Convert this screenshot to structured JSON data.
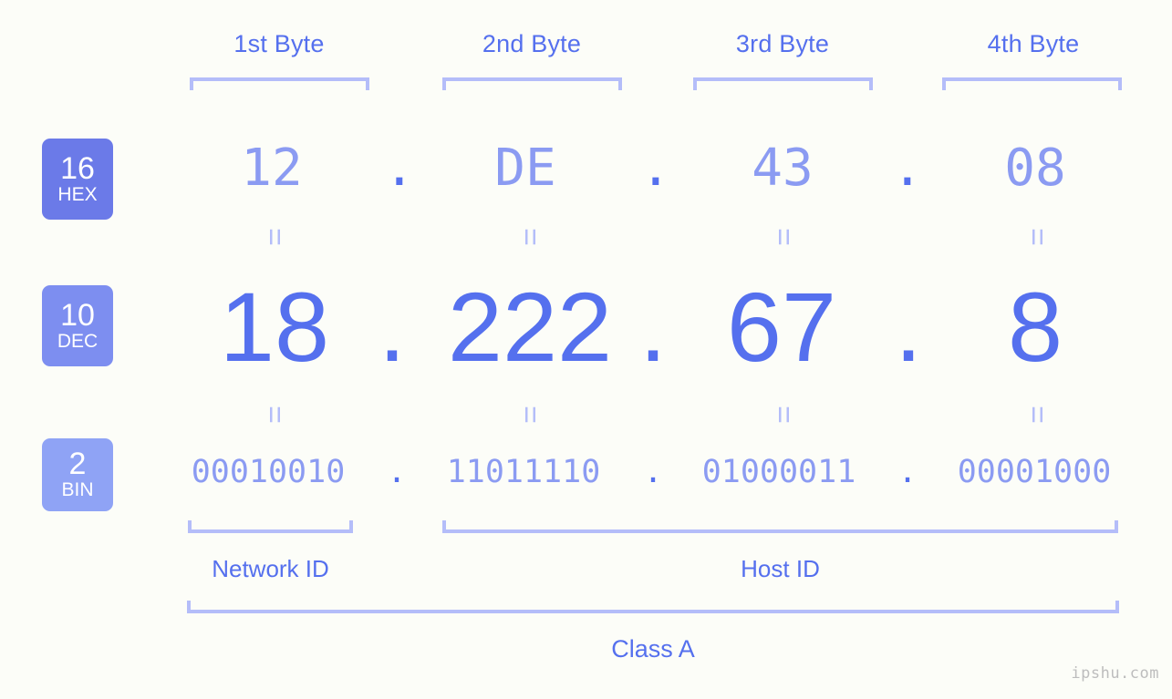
{
  "background_color": "#fcfdf8",
  "accent_colors": {
    "strong_blue": "#5570ee",
    "mid_blue": "#8b9bf2",
    "light_blue": "#b4bdf9",
    "badge_hex": "#6b7ae8",
    "badge_dec": "#7d8ef0",
    "badge_bin": "#8fa3f5",
    "watermark_gray": "#bdbdbd"
  },
  "byte_headers": [
    {
      "label": "1st Byte"
    },
    {
      "label": "2nd Byte"
    },
    {
      "label": "3rd Byte"
    },
    {
      "label": "4th Byte"
    }
  ],
  "bases": [
    {
      "number": "16",
      "name": "HEX"
    },
    {
      "number": "10",
      "name": "DEC"
    },
    {
      "number": "2",
      "name": "BIN"
    }
  ],
  "rows": {
    "hex": {
      "values": [
        "12",
        "DE",
        "43",
        "08"
      ],
      "separator": "."
    },
    "dec": {
      "values": [
        "18",
        "222",
        "67",
        "8"
      ],
      "separator": "."
    },
    "bin": {
      "values": [
        "00010010",
        "11011110",
        "01000011",
        "00001000"
      ],
      "separator": "."
    }
  },
  "equality_marks": {
    "glyph": "=",
    "count_per_gap": 4
  },
  "segments": {
    "network_id": {
      "label": "Network ID"
    },
    "host_id": {
      "label": "Host ID"
    }
  },
  "class": {
    "label": "Class A"
  },
  "watermark": {
    "text": "ipshu.com"
  }
}
